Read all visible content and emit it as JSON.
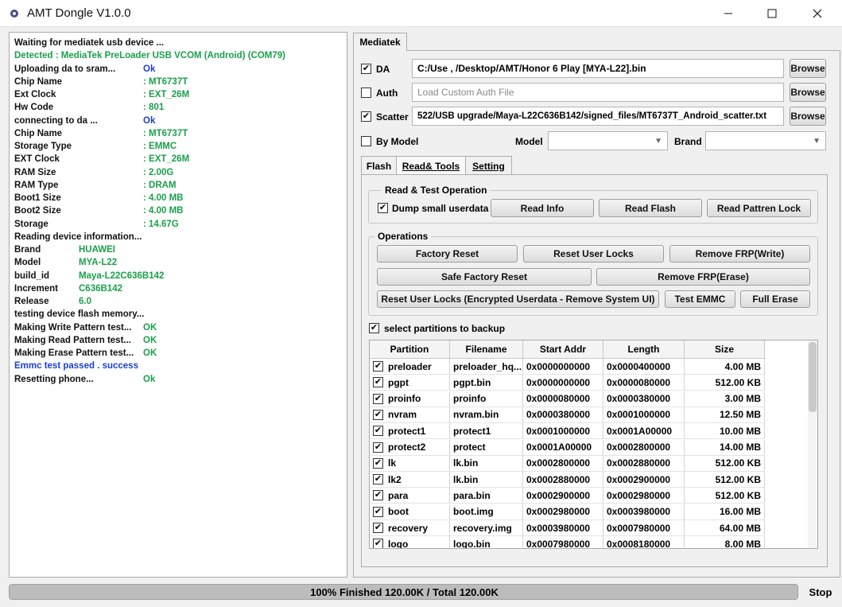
{
  "window": {
    "title": "AMT Dongle V1.0.0",
    "minimize_icon": "minimize-icon",
    "maximize_icon": "maximize-icon",
    "close_icon": "close-icon"
  },
  "log": [
    {
      "label": "Waiting for mediatek usb device ...",
      "label_color": "black",
      "value": "",
      "value_color": "black"
    },
    {
      "label": "Detected  :  MediaTek PreLoader USB VCOM (Android) (COM79)",
      "label_color": "green",
      "value": "",
      "value_color": "green"
    },
    {
      "label": "Uploading da to sram...",
      "label_color": "black",
      "value": "Ok",
      "value_color": "blue"
    },
    {
      "label": "Chip Name",
      "label_color": "black",
      "value": ": MT6737T",
      "value_color": "green"
    },
    {
      "label": "Ext Clock",
      "label_color": "black",
      "value": ": EXT_26M",
      "value_color": "green"
    },
    {
      "label": "Hw Code",
      "label_color": "black",
      "value": ": 801",
      "value_color": "green"
    },
    {
      "label": "connecting to da ...",
      "label_color": "black",
      "value": "Ok",
      "value_color": "blue"
    },
    {
      "label": "Chip Name",
      "label_color": "black",
      "value": ": MT6737T",
      "value_color": "green"
    },
    {
      "label": "Storage Type",
      "label_color": "black",
      "value": ": EMMC",
      "value_color": "green"
    },
    {
      "label": "EXT Clock",
      "label_color": "black",
      "value": ": EXT_26M",
      "value_color": "green"
    },
    {
      "label": "RAM Size",
      "label_color": "black",
      "value": ": 2.00G",
      "value_color": "green"
    },
    {
      "label": "RAM Type",
      "label_color": "black",
      "value": ": DRAM",
      "value_color": "green"
    },
    {
      "label": "Boot1 Size",
      "label_color": "black",
      "value": ": 4.00 MB",
      "value_color": "green"
    },
    {
      "label": "Boot2 Size",
      "label_color": "black",
      "value": ": 4.00 MB",
      "value_color": "green"
    },
    {
      "label": "Storage",
      "label_color": "black",
      "value": ": 14.67G",
      "value_color": "green"
    },
    {
      "label": "Reading device information...",
      "label_color": "black",
      "value": "",
      "value_color": "black"
    },
    {
      "label": "Brand",
      "label_color": "black",
      "value": "HUAWEI",
      "value_color": "green"
    },
    {
      "label": "Model",
      "label_color": "black",
      "value": "MYA-L22",
      "value_color": "green"
    },
    {
      "label": "build_id",
      "label_color": "black",
      "value": "Maya-L22C636B142",
      "value_color": "green"
    },
    {
      "label": "Increment",
      "label_color": "black",
      "value": "C636B142",
      "value_color": "green"
    },
    {
      "label": "Release",
      "label_color": "black",
      "value": "6.0",
      "value_color": "green"
    },
    {
      "label": "testing device flash memory...",
      "label_color": "black",
      "value": "",
      "value_color": "black"
    },
    {
      "label": "Making Write Pattern test...",
      "label_color": "black",
      "value": "OK",
      "value_color": "green"
    },
    {
      "label": "Making Read Pattern test...",
      "label_color": "black",
      "value": "OK",
      "value_color": "green"
    },
    {
      "label": "Making Erase Pattern test...",
      "label_color": "black",
      "value": "OK",
      "value_color": "green"
    },
    {
      "label": "Emmc test passed . success",
      "label_color": "blue",
      "value": "",
      "value_color": "blue"
    },
    {
      "label": "Resetting phone...",
      "label_color": "black",
      "value": "Ok",
      "value_color": "green"
    }
  ],
  "main_tab": "Mediatek",
  "da": {
    "label": "DA",
    "checked": true,
    "value": "C:/Use     ,        /Desktop/AMT/Honor 6 Play [MYA-L22].bin",
    "button": "Browse"
  },
  "auth": {
    "label": "Auth",
    "checked": false,
    "placeholder": "Load Custom Auth File",
    "button": "Browse"
  },
  "scatter": {
    "label": "Scatter",
    "checked": true,
    "value": "522/USB upgrade/Maya-L22C636B142/signed_files/MT6737T_Android_scatter.txt",
    "button": "Browse"
  },
  "by_model": {
    "label": "By Model",
    "checked": false,
    "model_label": "Model",
    "model_value": "",
    "brand_label": "Brand",
    "brand_value": ""
  },
  "sub_tabs": {
    "flash": "Flash",
    "read_tools": "Read& Tools",
    "setting": "Setting"
  },
  "read_test": {
    "title": "Read & Test Operation",
    "dump_label": "Dump small userdata",
    "dump_checked": true,
    "read_info": "Read Info",
    "read_flash": "Read Flash",
    "read_pattern_lock": "Read Pattren Lock"
  },
  "operations": {
    "title": "Operations",
    "factory_reset": "Factory Reset",
    "reset_user_locks": "Reset User Locks",
    "remove_frp_write": "Remove FRP(Write)",
    "safe_factory_reset": "Safe Factory Reset",
    "remove_frp_erase": "Remove FRP(Erase)",
    "reset_user_locks_encrypted": "Reset User Locks (Encrypted Userdata - Remove System UI)",
    "test_emmc": "Test EMMC",
    "full_erase": "Full Erase"
  },
  "backup": {
    "label": "select partitions to backup",
    "checked": true
  },
  "table": {
    "headers": [
      "Partition",
      "Filename",
      "Start Addr",
      "Length",
      "Size"
    ],
    "rows": [
      {
        "checked": true,
        "partition": "preloader",
        "filename": "preloader_hq...",
        "start": "0x0000000000",
        "length": "0x0000400000",
        "size": "4.00 MB"
      },
      {
        "checked": true,
        "partition": "pgpt",
        "filename": "pgpt.bin",
        "start": "0x0000000000",
        "length": "0x0000080000",
        "size": "512.00 KB"
      },
      {
        "checked": true,
        "partition": "proinfo",
        "filename": "proinfo",
        "start": "0x0000080000",
        "length": "0x0000380000",
        "size": "3.00 MB"
      },
      {
        "checked": true,
        "partition": "nvram",
        "filename": "nvram.bin",
        "start": "0x0000380000",
        "length": "0x0001000000",
        "size": "12.50 MB"
      },
      {
        "checked": true,
        "partition": "protect1",
        "filename": "protect1",
        "start": "0x0001000000",
        "length": "0x0001A00000",
        "size": "10.00 MB"
      },
      {
        "checked": true,
        "partition": "protect2",
        "filename": "protect",
        "start": "0x0001A00000",
        "length": "0x0002800000",
        "size": "14.00 MB"
      },
      {
        "checked": true,
        "partition": "lk",
        "filename": "lk.bin",
        "start": "0x0002800000",
        "length": "0x0002880000",
        "size": "512.00 KB"
      },
      {
        "checked": true,
        "partition": "lk2",
        "filename": "lk.bin",
        "start": "0x0002880000",
        "length": "0x0002900000",
        "size": "512.00 KB"
      },
      {
        "checked": true,
        "partition": "para",
        "filename": "para.bin",
        "start": "0x0002900000",
        "length": "0x0002980000",
        "size": "512.00 KB"
      },
      {
        "checked": true,
        "partition": "boot",
        "filename": "boot.img",
        "start": "0x0002980000",
        "length": "0x0003980000",
        "size": "16.00 MB"
      },
      {
        "checked": true,
        "partition": "recovery",
        "filename": "recovery.img",
        "start": "0x0003980000",
        "length": "0x0007980000",
        "size": "64.00 MB"
      },
      {
        "checked": true,
        "partition": "logo",
        "filename": "logo.bin",
        "start": "0x0007980000",
        "length": "0x0008180000",
        "size": "8.00 MB"
      }
    ]
  },
  "status": {
    "progress_fraction": 1.0,
    "text": "100% Finished 120.00K / Total 120.00K",
    "stop": "Stop"
  }
}
